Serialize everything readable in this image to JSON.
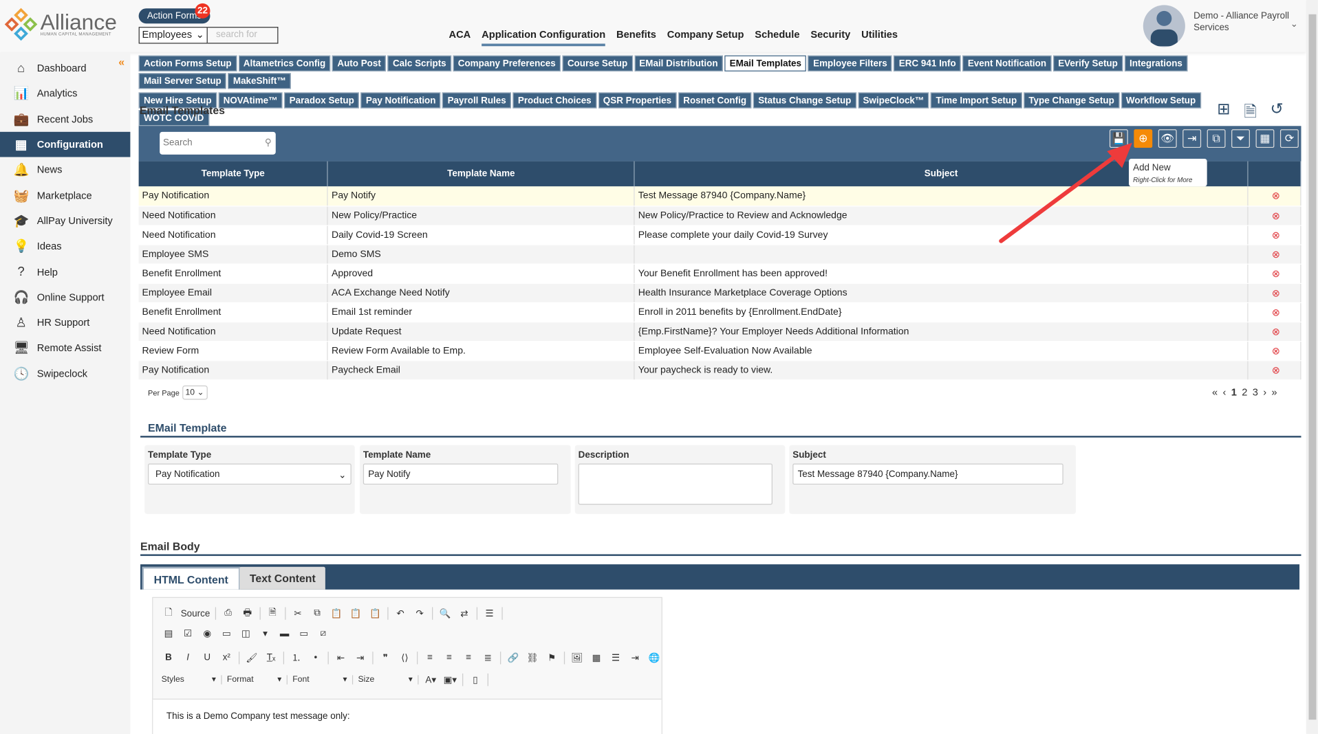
{
  "header": {
    "logo_text": "Alliance",
    "logo_sub": "HUMAN CAPITAL MANAGEMENT",
    "action_forms": "Action Forms",
    "action_forms_count": "22",
    "search_scope": "Employees",
    "search_placeholder": "search for",
    "nav": [
      "ACA",
      "Application Configuration",
      "Benefits",
      "Company Setup",
      "Schedule",
      "Security",
      "Utilities"
    ],
    "nav_active": "Application Configuration",
    "user": "Demo - Alliance Payroll Services"
  },
  "sidebar": {
    "items": [
      {
        "label": "Dashboard",
        "icon": "home-icon",
        "glyph": "⌂"
      },
      {
        "label": "Analytics",
        "icon": "analytics-icon",
        "glyph": "📊"
      },
      {
        "label": "Recent Jobs",
        "icon": "briefcase-icon",
        "glyph": "💼"
      },
      {
        "label": "Configuration",
        "icon": "building-icon",
        "glyph": "▦",
        "active": true
      },
      {
        "label": "News",
        "icon": "bell-icon",
        "glyph": "🔔"
      },
      {
        "label": "Marketplace",
        "icon": "basket-icon",
        "glyph": "🧺"
      },
      {
        "label": "AllPay University",
        "icon": "graduation-cap-icon",
        "glyph": "🎓"
      },
      {
        "label": "Ideas",
        "icon": "lightbulb-icon",
        "glyph": "💡"
      },
      {
        "label": "Help",
        "icon": "help-icon",
        "glyph": "?"
      },
      {
        "label": "Online Support",
        "icon": "headset-icon",
        "glyph": "🎧"
      },
      {
        "label": "HR Support",
        "icon": "person-icon",
        "glyph": "♙"
      },
      {
        "label": "Remote Assist",
        "icon": "monitor-icon",
        "glyph": "🖥"
      },
      {
        "label": "Swipeclock",
        "icon": "clock-icon",
        "glyph": "🕓"
      }
    ]
  },
  "subtabs": [
    "Action Forms Setup",
    "Altametrics Config",
    "Auto Post",
    "Calc Scripts",
    "Company Preferences",
    "Course Setup",
    "EMail Distribution",
    "EMail Templates",
    "Employee Filters",
    "ERC 941 Info",
    "Event Notification",
    "EVerify Setup",
    "Integrations",
    "Mail Server Setup",
    "MakeShift™",
    "New Hire Setup",
    "NOVAtime™",
    "Paradox Setup",
    "Pay Notification",
    "Payroll Rules",
    "Product Choices",
    "QSR Properties",
    "Rosnet Config",
    "Status Change Setup",
    "SwipeClock™",
    "Time Import Setup",
    "Type Change Setup",
    "Workflow Setup",
    "WOTC COVID"
  ],
  "subtabs_active": "EMail Templates",
  "page": {
    "title": "Email Templates",
    "search_placeholder": "Search",
    "tools": [
      {
        "name": "save-icon",
        "g": "💾"
      },
      {
        "name": "add-new-icon",
        "g": "⊕",
        "on": true
      },
      {
        "name": "preview-eye-icon",
        "g": "👁"
      },
      {
        "name": "export-icon",
        "g": "⇥"
      },
      {
        "name": "copy-icon",
        "g": "⧉"
      },
      {
        "name": "filter-icon",
        "g": "⏷"
      },
      {
        "name": "columns-grid-icon",
        "g": "▦"
      },
      {
        "name": "refresh-icon",
        "g": "⟳"
      }
    ],
    "tooltip": {
      "title": "Add New",
      "hint": "Right-Click for More"
    }
  },
  "table": {
    "columns": [
      "Template Type",
      "Template Name",
      "Subject",
      ""
    ],
    "rows": [
      [
        "Pay Notification",
        "Pay Notify",
        "Test Message 87940 {Company.Name}"
      ],
      [
        "Need Notification",
        "New Policy/Practice",
        "New Policy/Practice to Review and Acknowledge"
      ],
      [
        "Need Notification",
        "Daily Covid-19 Screen",
        "Please complete your daily Covid-19 Survey"
      ],
      [
        "Employee SMS",
        "Demo SMS",
        ""
      ],
      [
        "Benefit Enrollment",
        "Approved",
        "Your Benefit Enrollment has been approved!"
      ],
      [
        "Employee Email",
        "ACA Exchange Need Notify",
        "Health Insurance Marketplace Coverage Options"
      ],
      [
        "Benefit Enrollment",
        "Email 1st reminder",
        "Enroll in 2011 benefits by {Enrollment.EndDate}"
      ],
      [
        "Need Notification",
        "Update Request",
        "{Emp.FirstName}? Your Employer Needs Additional Information"
      ],
      [
        "Review Form",
        "Review Form Available to Emp.",
        "Employee Self-Evaluation Now Available"
      ],
      [
        "Pay Notification",
        "Paycheck Email",
        "Your paycheck is ready to view."
      ]
    ],
    "selected_row": 0,
    "per_page_label": "Per Page",
    "per_page": "10",
    "pages": [
      "1",
      "2",
      "3"
    ],
    "current_page": "1"
  },
  "form": {
    "section": "EMail Template",
    "type_label": "Template Type",
    "type_value": "Pay Notification",
    "name_label": "Template Name",
    "name_value": "Pay Notify",
    "desc_label": "Description",
    "desc_value": "",
    "subject_label": "Subject",
    "subject_value": "Test Message 87940 {Company.Name}"
  },
  "body": {
    "section": "Email Body",
    "tabs": [
      "HTML Content",
      "Text Content"
    ],
    "active_tab": "HTML Content",
    "source_label": "Source",
    "dropdowns": [
      "Styles",
      "Format",
      "Font",
      "Size"
    ],
    "content": "This is a Demo Company test message only:"
  },
  "colors": {
    "primary": "#2e4d6b",
    "accent": "#f58a07",
    "selected_row": "#fffde6",
    "delete": "#e0393e"
  }
}
